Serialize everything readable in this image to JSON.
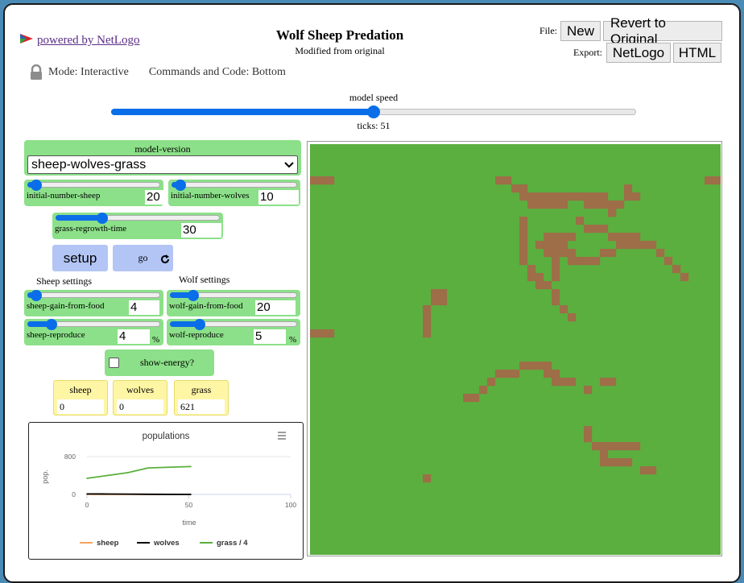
{
  "header": {
    "powered_by": "powered by NetLogo",
    "title": "Wolf Sheep Predation",
    "subtitle": "Modified from original",
    "file_label": "File:",
    "export_label": "Export:",
    "new_button": "New",
    "revert_button": "Revert to Original",
    "export_netlogo": "NetLogo",
    "export_html": "HTML"
  },
  "mode": {
    "mode_text": "Mode: Interactive",
    "commands_text": "Commands and Code: Bottom"
  },
  "speed": {
    "label": "model speed",
    "ticks_label": "ticks: 51",
    "value_fraction": 0.5
  },
  "chooser": {
    "label": "model-version",
    "selected": "sheep-wolves-grass"
  },
  "sliders": {
    "initial_number_sheep": {
      "label": "initial-number-sheep",
      "value": "20",
      "level": 0.08
    },
    "initial_number_wolves": {
      "label": "initial-number-wolves",
      "value": "10",
      "level": 0.05
    },
    "grass_regrowth_time": {
      "label": "grass-regrowth-time",
      "value": "30",
      "level": 0.3
    },
    "sheep_gain_from_food": {
      "label": "sheep-gain-from-food",
      "value": "4",
      "unit": "",
      "level": 0.08
    },
    "wolf_gain_from_food": {
      "label": "wolf-gain-from-food",
      "value": "20",
      "unit": "",
      "level": 0.2
    },
    "sheep_reproduce": {
      "label": "sheep-reproduce",
      "value": "4",
      "unit": "%",
      "level": 0.2
    },
    "wolf_reproduce": {
      "label": "wolf-reproduce",
      "value": "5",
      "unit": "%",
      "level": 0.25
    }
  },
  "buttons": {
    "setup": "setup",
    "go": "go"
  },
  "notes": {
    "sheep_settings": "Sheep settings",
    "wolf_settings": "Wolf settings"
  },
  "switch": {
    "label": "show-energy?",
    "checked": false
  },
  "monitors": [
    {
      "name": "sheep",
      "value": "0"
    },
    {
      "name": "wolves",
      "value": "0"
    },
    {
      "name": "grass",
      "value": "621"
    }
  ],
  "colors": {
    "widget_green": "#8ce089",
    "button_blue": "#b2c5f5",
    "monitor_yellow": "#fff6a5",
    "grass_green": "#5baf3f",
    "dirt_brown": "#9d6e48",
    "slider_blue": "#0a6ee8"
  },
  "chart_data": {
    "type": "line",
    "title": "populations",
    "xlabel": "time",
    "ylabel": "pop.",
    "xlim": [
      0,
      100
    ],
    "ylim": [
      0,
      800
    ],
    "xticks": [
      "0",
      "50",
      "100"
    ],
    "yticks": [
      "0",
      "800"
    ],
    "legend_position": "bottom",
    "series": [
      {
        "name": "sheep",
        "color": "#f4a460",
        "x": [
          0,
          10,
          20,
          30,
          40,
          51
        ],
        "y": [
          0,
          0,
          0,
          0,
          0,
          0
        ]
      },
      {
        "name": "wolves",
        "color": "#000000",
        "x": [
          0,
          10,
          20,
          30,
          40,
          51
        ],
        "y": [
          10,
          9,
          6,
          3,
          1,
          0
        ]
      },
      {
        "name": "grass / 4",
        "color": "#59b03c",
        "x": [
          0,
          10,
          20,
          30,
          40,
          51
        ],
        "y": [
          340,
          400,
          460,
          560,
          575,
          590
        ]
      }
    ]
  },
  "world": {
    "grid_size": 51,
    "green": "#5baf3f",
    "brown": "#9d6e48",
    "brown_patches": [
      [
        0,
        4
      ],
      [
        1,
        4
      ],
      [
        2,
        4
      ],
      [
        49,
        4
      ],
      [
        50,
        4
      ],
      [
        23,
        4
      ],
      [
        24,
        4
      ],
      [
        25,
        5
      ],
      [
        26,
        5
      ],
      [
        27,
        6
      ],
      [
        28,
        6
      ],
      [
        29,
        6
      ],
      [
        30,
        6
      ],
      [
        31,
        6
      ],
      [
        32,
        6
      ],
      [
        33,
        6
      ],
      [
        34,
        6
      ],
      [
        35,
        6
      ],
      [
        36,
        6
      ],
      [
        37,
        7
      ],
      [
        38,
        7
      ],
      [
        39,
        5
      ],
      [
        39,
        6
      ],
      [
        40,
        6
      ],
      [
        34,
        7
      ],
      [
        35,
        7
      ],
      [
        36,
        7
      ],
      [
        37,
        8
      ],
      [
        26,
        6
      ],
      [
        27,
        7
      ],
      [
        28,
        7
      ],
      [
        29,
        7
      ],
      [
        30,
        7
      ],
      [
        31,
        7
      ],
      [
        37,
        8
      ],
      [
        33,
        9
      ],
      [
        34,
        10
      ],
      [
        35,
        10
      ],
      [
        36,
        10
      ],
      [
        37,
        11
      ],
      [
        38,
        11
      ],
      [
        39,
        11
      ],
      [
        40,
        12
      ],
      [
        41,
        12
      ],
      [
        42,
        12
      ],
      [
        43,
        13
      ],
      [
        44,
        14
      ],
      [
        45,
        15
      ],
      [
        46,
        16
      ],
      [
        26,
        9
      ],
      [
        26,
        10
      ],
      [
        26,
        11
      ],
      [
        26,
        12
      ],
      [
        26,
        13
      ],
      [
        26,
        14
      ],
      [
        27,
        15
      ],
      [
        27,
        16
      ],
      [
        28,
        16
      ],
      [
        28,
        17
      ],
      [
        29,
        17
      ],
      [
        30,
        18
      ],
      [
        30,
        19
      ],
      [
        31,
        20
      ],
      [
        32,
        21
      ],
      [
        29,
        11
      ],
      [
        30,
        11
      ],
      [
        31,
        11
      ],
      [
        32,
        11
      ],
      [
        31,
        12
      ],
      [
        29,
        12
      ],
      [
        30,
        12
      ],
      [
        30,
        13
      ],
      [
        30,
        14
      ],
      [
        30,
        15
      ],
      [
        30,
        16
      ],
      [
        31,
        13
      ],
      [
        32,
        13
      ],
      [
        32,
        14
      ],
      [
        33,
        14
      ],
      [
        34,
        14
      ],
      [
        35,
        14
      ],
      [
        36,
        13
      ],
      [
        37,
        13
      ],
      [
        38,
        12
      ],
      [
        39,
        12
      ],
      [
        29,
        13
      ],
      [
        28,
        12
      ],
      [
        37,
        11
      ],
      [
        38,
        11
      ],
      [
        39,
        11
      ],
      [
        40,
        11
      ],
      [
        15,
        18
      ],
      [
        16,
        18
      ],
      [
        16,
        19
      ],
      [
        15,
        19
      ],
      [
        14,
        20
      ],
      [
        14,
        21
      ],
      [
        14,
        22
      ],
      [
        14,
        23
      ],
      [
        0,
        23
      ],
      [
        1,
        23
      ],
      [
        2,
        23
      ],
      [
        26,
        27
      ],
      [
        27,
        27
      ],
      [
        28,
        27
      ],
      [
        29,
        27
      ],
      [
        29,
        28
      ],
      [
        30,
        28
      ],
      [
        23,
        28
      ],
      [
        24,
        28
      ],
      [
        25,
        28
      ],
      [
        22,
        29
      ],
      [
        21,
        30
      ],
      [
        20,
        31
      ],
      [
        19,
        31
      ],
      [
        30,
        29
      ],
      [
        31,
        29
      ],
      [
        32,
        29
      ],
      [
        34,
        30
      ],
      [
        36,
        29
      ],
      [
        37,
        29
      ],
      [
        34,
        35
      ],
      [
        34,
        36
      ],
      [
        35,
        37
      ],
      [
        36,
        37
      ],
      [
        37,
        37
      ],
      [
        38,
        37
      ],
      [
        39,
        37
      ],
      [
        40,
        37
      ],
      [
        36,
        38
      ],
      [
        36,
        39
      ],
      [
        37,
        39
      ],
      [
        38,
        39
      ],
      [
        39,
        39
      ],
      [
        41,
        40
      ],
      [
        42,
        40
      ],
      [
        14,
        41
      ]
    ]
  }
}
